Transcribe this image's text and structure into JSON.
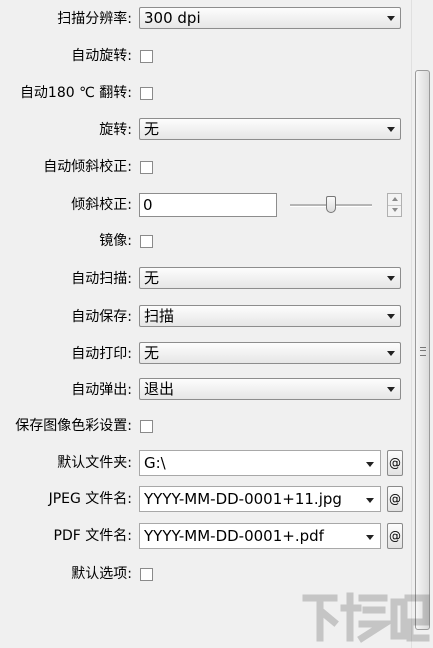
{
  "settings": {
    "scan_resolution": {
      "label": "扫描分辨率:",
      "value": "300 dpi"
    },
    "auto_rotate": {
      "label": "自动旋转:",
      "checked": false
    },
    "auto_flip": {
      "label": "自动180 ℃ 翻转:",
      "checked": false
    },
    "rotate": {
      "label": "旋转:",
      "value": "无"
    },
    "auto_deskew": {
      "label": "自动倾斜校正:",
      "checked": false
    },
    "deskew": {
      "label": "倾斜校正:",
      "value": "0"
    },
    "mirror": {
      "label": "镜像:",
      "checked": false
    },
    "auto_scan": {
      "label": "自动扫描:",
      "value": "无"
    },
    "auto_save": {
      "label": "自动保存:",
      "value": "扫描"
    },
    "auto_print": {
      "label": "自动打印:",
      "value": "无"
    },
    "auto_eject": {
      "label": "自动弹出:",
      "value": "退出"
    },
    "save_color_settings": {
      "label": "保存图像色彩设置:",
      "checked": false
    },
    "default_folder": {
      "label": "默认文件夹:",
      "value": "G:\\"
    },
    "jpeg_filename": {
      "label": "JPEG 文件名:",
      "value": "YYYY-MM-DD-0001+11.jpg"
    },
    "pdf_filename": {
      "label": "PDF 文件名:",
      "value": "YYYY-MM-DD-0001+.pdf"
    },
    "default_options": {
      "label": "默认选项:",
      "checked": false
    }
  },
  "macro_button_label": "@",
  "watermark": {
    "text": "下载吧"
  },
  "icons": {
    "dropdown": "chevron-down-icon",
    "spinner_up": "spin-up-icon",
    "spinner_down": "spin-down-icon",
    "grip": "scroll-grip-icon"
  }
}
